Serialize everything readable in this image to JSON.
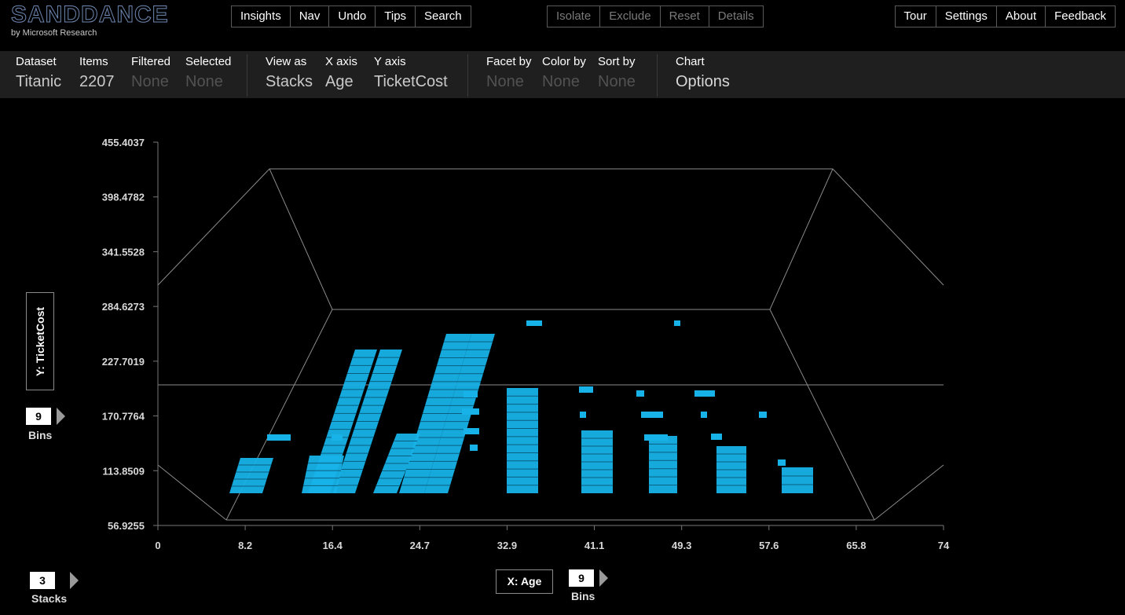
{
  "app": {
    "logo": "SANDDANCE",
    "logo_sub": "by Microsoft Research"
  },
  "toolbar": {
    "left": [
      "Insights",
      "Nav",
      "Undo",
      "Tips",
      "Search"
    ],
    "center": [
      "Isolate",
      "Exclude",
      "Reset",
      "Details"
    ],
    "right": [
      "Tour",
      "Settings",
      "About",
      "Feedback"
    ]
  },
  "info": {
    "dataset": {
      "label": "Dataset",
      "value": "Titanic"
    },
    "items": {
      "label": "Items",
      "value": "2207"
    },
    "filtered": {
      "label": "Filtered",
      "value": "None"
    },
    "selected": {
      "label": "Selected",
      "value": "None"
    },
    "view_as": {
      "label": "View as",
      "value": "Stacks"
    },
    "x_axis": {
      "label": "X axis",
      "value": "Age"
    },
    "y_axis": {
      "label": "Y axis",
      "value": "TicketCost"
    },
    "facet_by": {
      "label": "Facet by",
      "value": "None"
    },
    "color_by": {
      "label": "Color by",
      "value": "None"
    },
    "sort_by": {
      "label": "Sort by",
      "value": "None"
    },
    "chart": {
      "label": "Chart",
      "value": "Options"
    }
  },
  "y_axis_label": "Y: TicketCost",
  "x_axis_label": "X: Age",
  "y_bins": {
    "value": "9",
    "label": "Bins"
  },
  "x_bins": {
    "value": "9",
    "label": "Bins"
  },
  "stacks": {
    "value": "3",
    "label": "Stacks"
  },
  "colors": {
    "accent": "#17b2e8",
    "background": "#000000",
    "panel": "#1f1f1f"
  },
  "chart_data": {
    "type": "bar",
    "view": "3d-stacks",
    "x_ticks": [
      "0",
      "8.2",
      "16.4",
      "24.7",
      "32.9",
      "41.1",
      "49.3",
      "57.6",
      "65.8",
      "74"
    ],
    "y_ticks": [
      "56.9255",
      "113.8509",
      "170.7764",
      "227.7019",
      "284.6273",
      "341.5528",
      "398.4782",
      "455.4037"
    ],
    "xlim": [
      0,
      74
    ],
    "ylim": [
      56.9255,
      455.4037
    ]
  }
}
